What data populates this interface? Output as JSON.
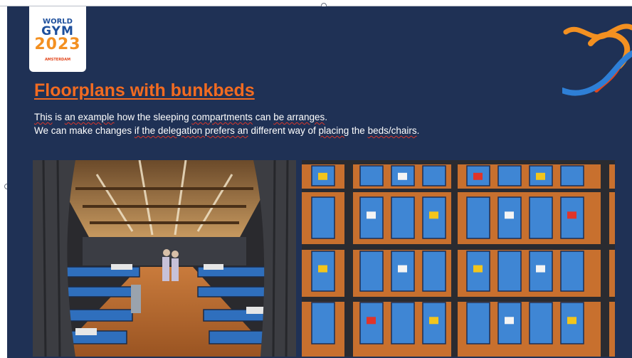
{
  "logo": {
    "line1": "WORLD",
    "line2": "GYM",
    "line3": "2023",
    "line4": "AMSTERDAM"
  },
  "slide": {
    "title": "Floorplans with bunkbeds",
    "body": {
      "line1": {
        "w1": "This",
        "t1": " is ",
        "w2": "an example",
        "t2": " how the sleeping ",
        "w3": "compartments",
        "t3": " can ",
        "w4": "be arranges",
        "t4": "."
      },
      "line2": {
        "t1": "We can make changes ",
        "w1": "if the delegation prefers an",
        "t2": " different way of ",
        "w2": "placing",
        "t3": " the ",
        "w3": "beds/chairs",
        "t4": "."
      }
    }
  },
  "colors": {
    "slide_background": "#1f3155",
    "title": "#f26b21",
    "text": "#ffffff",
    "brand_orange": "#f39021",
    "brand_blue": "#2e7fd6"
  },
  "icons": [
    "ribbon-decoration-icon",
    "world-gym-logo"
  ]
}
